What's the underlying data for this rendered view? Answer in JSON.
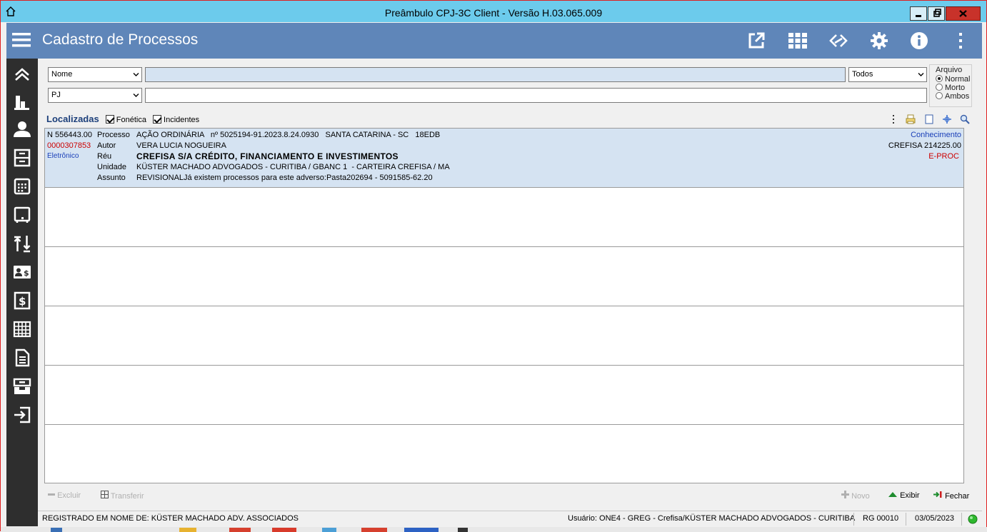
{
  "window": {
    "title": "Preâmbulo CPJ-3C Client - Versão H.03.065.009"
  },
  "header": {
    "page_title": "Cadastro de Processos",
    "icons": [
      "open-external-icon",
      "grid-apps-icon",
      "link-diamond-icon",
      "gear-icon",
      "info-icon",
      "more-vertical-icon"
    ]
  },
  "sidebar": {
    "icons": [
      "chevrons-up-icon",
      "bar-chart-icon",
      "person-icon",
      "archive-box-icon",
      "calendar-icon",
      "monitor-icon",
      "sort-arrows-icon",
      "id-card-money-icon",
      "dollar-box-icon",
      "table-icon",
      "document-icon",
      "inbox-icon",
      "sign-in-icon"
    ]
  },
  "search": {
    "field1_select": "Nome",
    "field1_value": "",
    "filter_select": "Todos",
    "field2_select": "PJ",
    "field2_value": "",
    "arquivo": {
      "legend": "Arquivo",
      "options": [
        "Normal",
        "Morto",
        "Ambos"
      ],
      "selected": "Normal"
    }
  },
  "results": {
    "title": "Localizadas",
    "checkbox_fonetica": "Fonética",
    "checkbox_incidentes": "Incidentes",
    "toolbar_icons": [
      "more-vertical-icon",
      "printer-icon",
      "blank-page-icon",
      "expand-icon",
      "magnifier-icon"
    ]
  },
  "record": {
    "number": "N 556443.00",
    "code": "0000307853",
    "type": "Eletrônico",
    "label_processo": "Processo",
    "label_autor": "Autor",
    "label_reu": "Réu",
    "label_unidade": "Unidade",
    "label_assunto": "Assunto",
    "processo": "AÇÃO ORDINÁRIA   nº 5025194-91.2023.8.24.0930   SANTA CATARINA - SC   18EDB",
    "autor": "VERA LUCIA NOGUEIRA",
    "reu": "CREFISA S/A CRÉDITO, FINANCIAMENTO E INVESTIMENTOS",
    "unidade": "KÜSTER MACHADO ADVOGADOS - CURITIBA / GBANC 1  - CARTEIRA CREFISA / MA",
    "assunto": "REVISIONALJá existem processos para este adverso:Pasta202694 - 5091585-62.20",
    "fase": "Conhecimento",
    "cliente": "CREFISA 214225.00",
    "sistema": "E-PROC"
  },
  "footer": {
    "excluir": "Excluir",
    "transferir": "Transferir",
    "novo": "Novo",
    "exibir": "Exibir",
    "fechar": "Fechar"
  },
  "status": {
    "registrado": "REGISTRADO EM NOME DE: KÜSTER MACHADO ADV. ASSOCIADOS",
    "usuario": "Usuário: ONE4 - GREG - Crefisa/KÜSTER MACHADO ADVOGADOS - CURITIBA",
    "rg": "RG 00010",
    "date": "03/05/2023"
  },
  "colors": {
    "titlebar": "#6ccbec",
    "header": "#5f86b9",
    "sidebar": "#2e2e2e",
    "selected_row": "#d5e3f2",
    "accent_red": "#cc0000",
    "accent_blue": "#1a3fb8",
    "status_ok": "#2eb82e"
  }
}
